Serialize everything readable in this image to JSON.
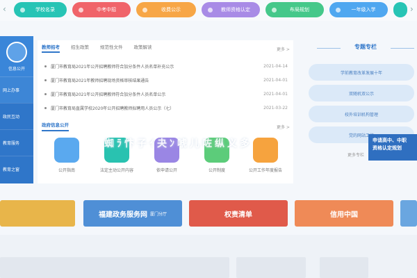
{
  "topbar": {
    "prev_icon": "chevron-left-icon",
    "next_icon": "chevron-right-icon",
    "pills": [
      {
        "label": "学校名录",
        "color": "#27c4b5"
      },
      {
        "label": "中考中招",
        "color": "#f0646a"
      },
      {
        "label": "收费公示",
        "color": "#f7a646"
      },
      {
        "label": "教师资格认定",
        "color": "#a88be6"
      },
      {
        "label": "布局规划",
        "color": "#45c88a"
      },
      {
        "label": "一年级入学",
        "color": "#4fa7f0"
      },
      {
        "label": "",
        "color": "#27c4b5"
      }
    ]
  },
  "leftnav": {
    "head_label": "信息公开",
    "items": [
      "网上办事",
      "政民互动",
      "教育服务",
      "教育之窗"
    ]
  },
  "panel": {
    "tabs": [
      "教师招考",
      "招生政策",
      "规范性文件",
      "政策解读"
    ],
    "more_label": "更多 >",
    "news": [
      {
        "title": "厦门市教育局2021年公开招聘教师符合加分条件人员名单补充公示",
        "date": "2021-04-14"
      },
      {
        "title": "厦门市教育局2021年教师招聘现场资格审核结果通告",
        "date": "2021-04-01"
      },
      {
        "title": "厦门市教育局2021年公开招聘教师符合加分条件人员名单公示",
        "date": "2021-04-01"
      },
      {
        "title": "厦门市教育局直属学校2020年公开招聘教师拟聘用人员公示（七）",
        "date": "2021-03-22"
      }
    ],
    "section2_title": "政府信息公开",
    "section2_more": "更多 >",
    "icons": [
      {
        "label": "公开指南",
        "color": "#5aa9ef",
        "icon": "document-icon"
      },
      {
        "label": "法定主动公开内容",
        "color": "#29c2b0",
        "icon": "list-icon"
      },
      {
        "label": "依申请公开",
        "color": "#9a86e4",
        "icon": "request-icon"
      },
      {
        "label": "公开制度",
        "color": "#5ccc7a",
        "icon": "rules-icon"
      },
      {
        "label": "公开工作年度报告",
        "color": "#f6a33e",
        "icon": "report-icon"
      }
    ]
  },
  "overlay_text": "蜘ﾗ忭子ｲ夬ﾝ唬儿咗纵义多",
  "right": {
    "title": "专题专栏",
    "buttons": [
      "学前教育改革发展十年",
      "双随机双公示",
      "校外培训机构管理",
      "党的网站工作"
    ],
    "tail_label": "更多专栏",
    "overlay_box": "申请高中、中职 资格认定规划"
  },
  "banners": [
    {
      "label": "",
      "sub": "",
      "color": "#e8b54a"
    },
    {
      "label": "福建政务服务网",
      "sub": "厦门分厅",
      "color": "#4f8fd6"
    },
    {
      "label": "权责清单",
      "sub": "",
      "color": "#e05a4a"
    },
    {
      "label": "信用中国",
      "sub": "",
      "color": "#ef8a57"
    },
    {
      "label": "",
      "sub": "",
      "color": "#6aa6e0"
    }
  ]
}
